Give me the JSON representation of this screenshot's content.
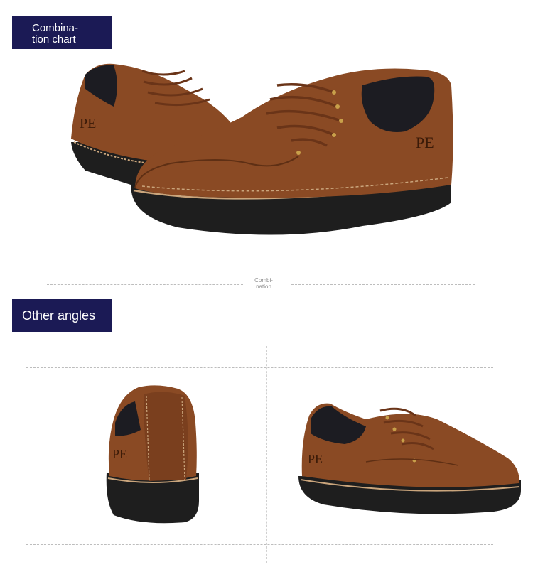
{
  "section_combination": {
    "label_line1": "Combina-",
    "label_line2": "tion chart"
  },
  "divider_caption": {
    "line1": "Combi-",
    "line2": "nation"
  },
  "section_angles": {
    "label": "Other angles"
  },
  "brand_mark": "PE",
  "colors": {
    "label_background": "#1b1a55",
    "label_text": "#ffffff",
    "leather": "#8a4a24",
    "leather_dark": "#5e2f14",
    "collar": "#1c1c22",
    "sole": "#1e1e1e",
    "welt_stitch": "#caa57c",
    "lace": "#6a3418"
  }
}
